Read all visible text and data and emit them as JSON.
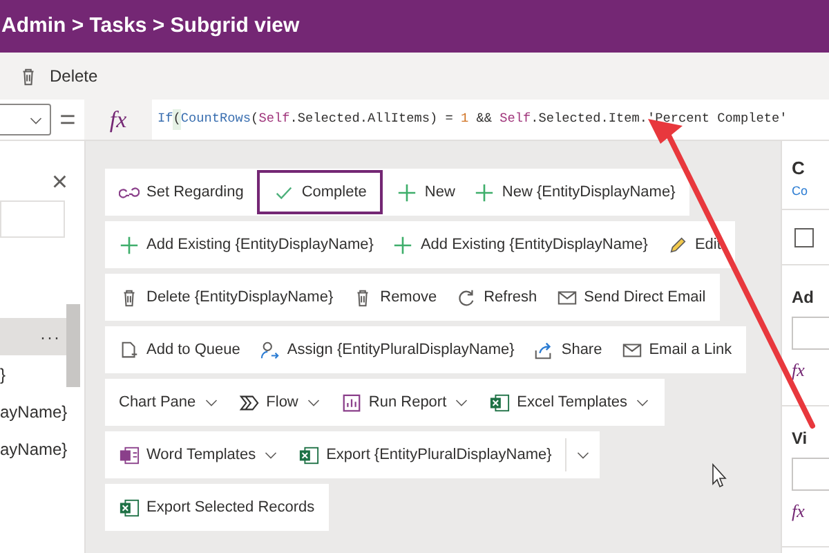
{
  "title_bar": {
    "breadcrumb": "Admin > Tasks > Subgrid view"
  },
  "toolbar": {
    "buttons": [
      {
        "label": "Delete"
      }
    ]
  },
  "formula_bar": {
    "equals": "=",
    "fx": "fx",
    "tokens": [
      {
        "text": "If",
        "kind": "function"
      },
      {
        "text": "(",
        "kind": "bracket"
      },
      {
        "text": "CountRows",
        "kind": "function"
      },
      {
        "text": "(",
        "kind": "plain"
      },
      {
        "text": "Self",
        "kind": "identifier"
      },
      {
        "text": ".Selected.AllItems) = ",
        "kind": "plain"
      },
      {
        "text": "1",
        "kind": "number"
      },
      {
        "text": " && ",
        "kind": "plain"
      },
      {
        "text": "Self",
        "kind": "identifier"
      },
      {
        "text": ".Selected.Item.'Percent Complete'",
        "kind": "plain"
      }
    ]
  },
  "left_panel": {
    "close": "×",
    "rows": [
      {
        "menu": "···",
        "selected": true
      },
      {
        "label": "}",
        "selected": false
      },
      {
        "label": "ayName}",
        "selected": false
      },
      {
        "label": "ayName}",
        "selected": false
      }
    ]
  },
  "command_rows": [
    [
      {
        "label": "Set Regarding",
        "kind": "button",
        "selected": false
      },
      {
        "label": "Complete",
        "kind": "button",
        "selected": true
      },
      {
        "label": "New",
        "kind": "button",
        "selected": false
      },
      {
        "label": "New {EntityDisplayName}",
        "kind": "button",
        "selected": false
      }
    ],
    [
      {
        "label": "Add Existing {EntityDisplayName}",
        "kind": "button",
        "selected": false
      },
      {
        "label": "Add Existing {EntityDisplayName}",
        "kind": "button",
        "selected": false
      },
      {
        "label": "Edit",
        "kind": "button",
        "selected": false
      }
    ],
    [
      {
        "label": "Delete {EntityDisplayName}",
        "kind": "button",
        "selected": false
      },
      {
        "label": "Remove",
        "kind": "button",
        "selected": false
      },
      {
        "label": "Refresh",
        "kind": "button",
        "selected": false
      },
      {
        "label": "Send Direct Email",
        "kind": "button",
        "selected": false
      }
    ],
    [
      {
        "label": "Add to Queue",
        "kind": "button",
        "selected": false
      },
      {
        "label": "Assign {EntityPluralDisplayName}",
        "kind": "button",
        "selected": false
      },
      {
        "label": "Share",
        "kind": "button",
        "selected": false
      },
      {
        "label": "Email a Link",
        "kind": "button",
        "selected": false
      }
    ],
    [
      {
        "label": "Chart Pane",
        "kind": "dropdown",
        "selected": false
      },
      {
        "label": "Flow",
        "kind": "dropdown",
        "selected": false
      },
      {
        "label": "Run Report",
        "kind": "dropdown",
        "selected": false
      },
      {
        "label": "Excel Templates",
        "kind": "dropdown",
        "selected": false
      }
    ],
    [
      {
        "label": "Word Templates",
        "kind": "dropdown",
        "selected": false
      },
      {
        "label": "Export {EntityPluralDisplayName}",
        "kind": "split",
        "selected": false
      }
    ],
    [
      {
        "label": "Export Selected Records",
        "kind": "button",
        "selected": false
      }
    ]
  ],
  "right_panel": {
    "title": "C",
    "subtitle": "Co",
    "checkbox": {
      "checked": false
    },
    "sections": [
      {
        "label": "Ad",
        "fx": "fx"
      },
      {
        "label": "Vi",
        "fx": "fx"
      }
    ]
  }
}
